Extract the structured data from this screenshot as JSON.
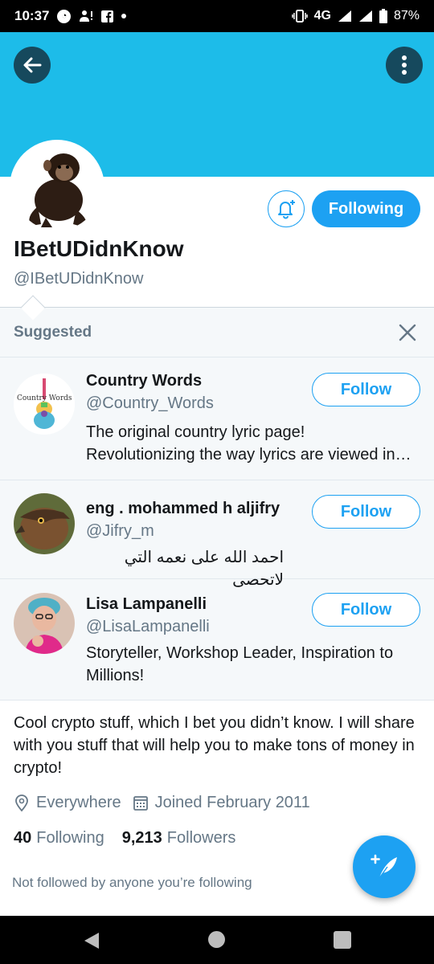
{
  "status_bar": {
    "time": "10:37",
    "network": "4G",
    "battery": "87%"
  },
  "profile": {
    "display_name": "IBetUDidnKnow",
    "handle": "@IBetUDidnKnow",
    "following_button": "Following",
    "bio": "Cool crypto stuff, which I bet you didn’t know. I will share with you stuff that will help you to make tons of money in crypto!",
    "location": "Everywhere",
    "joined": "Joined February 2011",
    "following_count": "40",
    "following_label": "Following",
    "followers_count": "9,213",
    "followers_label": "Followers",
    "not_followed": "Not followed by anyone you’re following"
  },
  "suggested": {
    "title": "Suggested",
    "follow_label": "Follow",
    "items": [
      {
        "name": "Country Words",
        "handle": "@Country_Words",
        "bio": "The original country lyric page! Revolutionizing the way lyrics are viewed in…",
        "avatar_text": "Country Words"
      },
      {
        "name": "eng . mohammed h aljifry",
        "handle": "@Jifry_m",
        "bio": "احمد الله على نعمه التي لاتحصى"
      },
      {
        "name": "Lisa Lampanelli",
        "handle": "@LisaLampanelli",
        "bio": "Storyteller, Workshop Leader, Inspiration to Millions!"
      }
    ]
  },
  "colors": {
    "banner": "#1dbce9",
    "accent": "#1da1f2",
    "dark_button": "#16495d",
    "muted_text": "#657786"
  },
  "icons": [
    "back-arrow-icon",
    "more-vertical-icon",
    "notification-bell-icon",
    "close-icon",
    "location-pin-icon",
    "calendar-icon",
    "compose-tweet-icon"
  ]
}
